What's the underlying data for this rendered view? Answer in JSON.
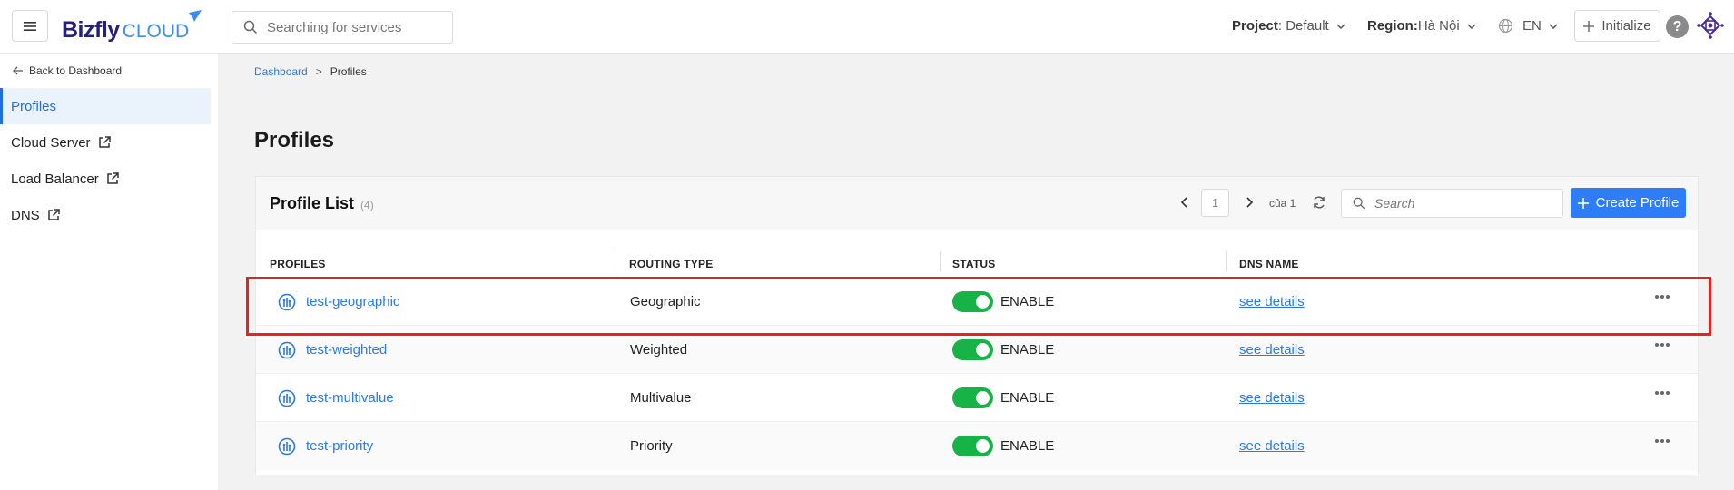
{
  "header": {
    "logo_main": "Bizfly",
    "logo_sub": "CLOUD",
    "search_placeholder": "Searching for services",
    "project_label": "Project",
    "project_value": " : Default",
    "region_label": "Region:",
    "region_value": " Hà Nội",
    "language": "EN",
    "initialize_label": "Initialize",
    "help_label": "?"
  },
  "sidebar": {
    "back_label": "Back to Dashboard",
    "items": [
      {
        "label": "Profiles",
        "active": true,
        "external": false
      },
      {
        "label": "Cloud Server",
        "active": false,
        "external": true
      },
      {
        "label": "Load Balancer",
        "active": false,
        "external": true
      },
      {
        "label": "DNS",
        "active": false,
        "external": true
      }
    ]
  },
  "breadcrumb": {
    "root": "Dashboard",
    "separator": ">",
    "current": "Profiles"
  },
  "page": {
    "title": "Profiles"
  },
  "list": {
    "title": "Profile List",
    "count": "(4)",
    "page_number": "1",
    "page_of": "của 1",
    "search_placeholder": "Search",
    "create_label": "Create Profile",
    "columns": [
      "PROFILES",
      "ROUTING TYPE",
      "STATUS",
      "DNS NAME"
    ],
    "rows": [
      {
        "name": "test-geographic",
        "routing_type": "Geographic",
        "status": "ENABLE",
        "dns": "see details",
        "enabled": true
      },
      {
        "name": "test-weighted",
        "routing_type": "Weighted",
        "status": "ENABLE",
        "dns": "see details",
        "enabled": true
      },
      {
        "name": "test-multivalue",
        "routing_type": "Multivalue",
        "status": "ENABLE",
        "dns": "see details",
        "enabled": true
      },
      {
        "name": "test-priority",
        "routing_type": "Priority",
        "status": "ENABLE",
        "dns": "see details",
        "enabled": true
      }
    ]
  },
  "colors": {
    "accent": "#2f7df6",
    "link": "#2a7ae2",
    "toggle_on": "#18b346",
    "highlight": "#e32222"
  }
}
